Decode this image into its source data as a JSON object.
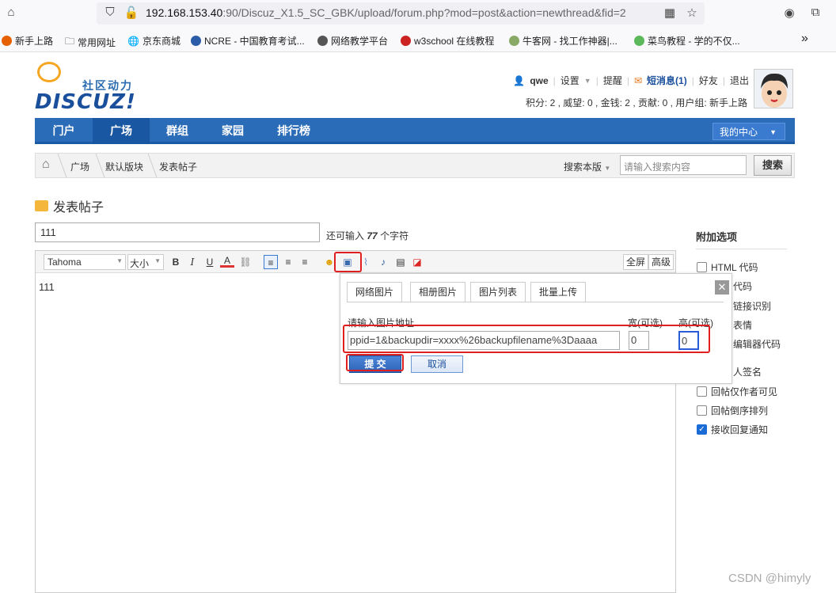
{
  "browser": {
    "url_host": "192.168.153.40",
    "url_rest": ":90/Discuz_X1.5_SC_GBK/upload/forum.php?mod=post&action=newthread&fid=2",
    "bookmarks": [
      "新手上路",
      "常用网址",
      "京东商城",
      "NCRE - 中国教育考试...",
      "网络教学平台",
      "w3school 在线教程",
      "牛客网 - 找工作神器|...",
      "菜鸟教程 - 学的不仅..."
    ]
  },
  "header": {
    "slogan": "社区动力",
    "logo": "DISCUZ!",
    "username": "qwe",
    "settings": "设置",
    "remind": "提醒",
    "pm": "短消息(1)",
    "friends": "好友",
    "logout": "退出",
    "credits": "积分: 2 , 威望: 0 , 金钱: 2 , 贡献: 0 , 用户组: 新手上路"
  },
  "nav": {
    "items": [
      "门户",
      "广场",
      "群组",
      "家园",
      "排行榜"
    ],
    "my_center": "我的中心"
  },
  "breadcrumb": {
    "items": [
      "广场",
      "默认版块",
      "发表帖子"
    ],
    "search_scope": "搜索本版",
    "search_placeholder": "请输入搜索内容",
    "search_button": "搜索"
  },
  "page": {
    "title": "发表帖子",
    "subject": "111",
    "remain_prefix": "还可输入",
    "remain_count": "77",
    "remain_suffix": "个字符"
  },
  "editor": {
    "font": "Tahoma",
    "size": "大小",
    "fullscreen": "全屏",
    "advanced": "高级",
    "content": "111"
  },
  "image_dialog": {
    "tabs": [
      "网络图片",
      "相册图片",
      "图片列表",
      "批量上传"
    ],
    "url_label": "请输入图片地址",
    "width_label": "宽(可选)",
    "height_label": "高(可选)",
    "url_value": "ppid=1&backupdir=xxxx%26backupfilename%3Daaaa",
    "width_value": "0",
    "height_value": "0",
    "submit": "提 交",
    "cancel": "取消"
  },
  "sidebar": {
    "title": "附加选项",
    "options": [
      {
        "label": "HTML 代码",
        "checked": false
      },
      {
        "label": "代码",
        "checked": false
      },
      {
        "label": "链接识别",
        "checked": false
      },
      {
        "label": "表情",
        "checked": false
      },
      {
        "label": "编辑器代码",
        "checked": false
      },
      {
        "label": "人签名",
        "checked": false
      },
      {
        "label": "回帖仅作者可见",
        "checked": false
      },
      {
        "label": "回帖倒序排列",
        "checked": false
      },
      {
        "label": "接收回复通知",
        "checked": true
      }
    ]
  },
  "watermark": "CSDN @himyly",
  "colors": {
    "nav": "#2b6cb8",
    "highlight": "#e02020",
    "accent": "#1a4f9c"
  }
}
